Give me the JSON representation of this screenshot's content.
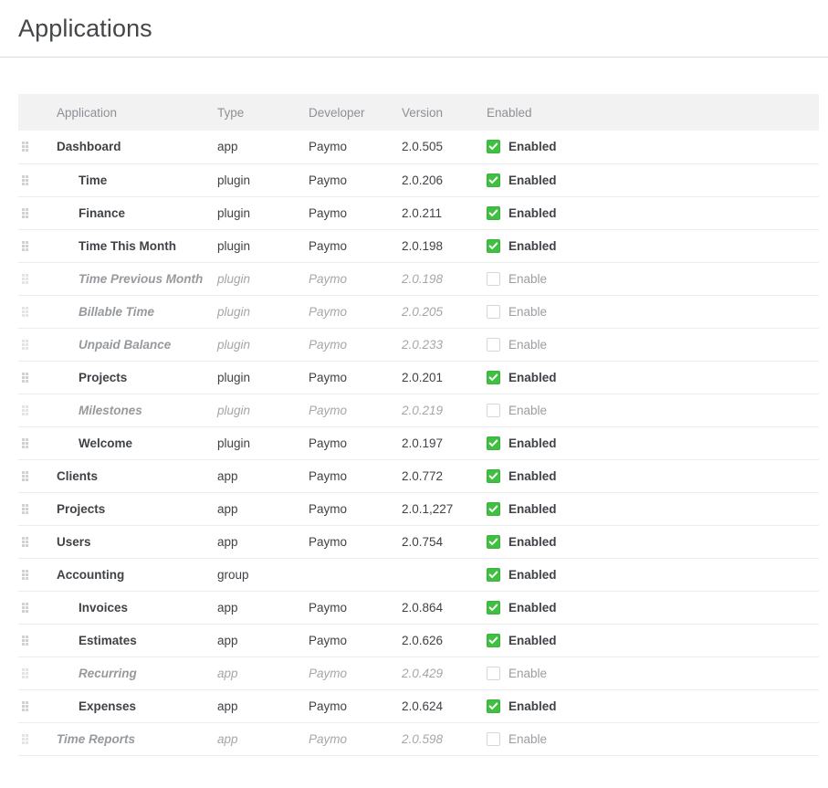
{
  "page": {
    "title": "Applications"
  },
  "table": {
    "columns": {
      "handle": "",
      "application": "Application",
      "type": "Type",
      "developer": "Developer",
      "version": "Version",
      "enabled": "Enabled"
    },
    "labels": {
      "enabled": "Enabled",
      "disabled": "Enable"
    },
    "colors": {
      "checkbox_on": "#40c040",
      "checkbox_off_border": "#d4d6d8",
      "header_bg": "#f2f2f2",
      "row_border": "#ececec",
      "text": "#3f4246",
      "muted_text": "#8d9095"
    },
    "icons": {
      "drag": "drag-handle-icon",
      "check": "check-icon"
    },
    "rows": [
      {
        "name": "Dashboard",
        "level": 1,
        "type": "app",
        "developer": "Paymo",
        "version": "2.0.505",
        "enabled": true,
        "enabled_label": "Enabled"
      },
      {
        "name": "Time",
        "level": 2,
        "type": "plugin",
        "developer": "Paymo",
        "version": "2.0.206",
        "enabled": true,
        "enabled_label": "Enabled"
      },
      {
        "name": "Finance",
        "level": 2,
        "type": "plugin",
        "developer": "Paymo",
        "version": "2.0.211",
        "enabled": true,
        "enabled_label": "Enabled"
      },
      {
        "name": "Time This Month",
        "level": 2,
        "type": "plugin",
        "developer": "Paymo",
        "version": "2.0.198",
        "enabled": true,
        "enabled_label": "Enabled"
      },
      {
        "name": "Time Previous Month",
        "level": 2,
        "type": "plugin",
        "developer": "Paymo",
        "version": "2.0.198",
        "enabled": false,
        "enabled_label": "Enable"
      },
      {
        "name": "Billable Time",
        "level": 2,
        "type": "plugin",
        "developer": "Paymo",
        "version": "2.0.205",
        "enabled": false,
        "enabled_label": "Enable"
      },
      {
        "name": "Unpaid Balance",
        "level": 2,
        "type": "plugin",
        "developer": "Paymo",
        "version": "2.0.233",
        "enabled": false,
        "enabled_label": "Enable"
      },
      {
        "name": "Projects",
        "level": 2,
        "type": "plugin",
        "developer": "Paymo",
        "version": "2.0.201",
        "enabled": true,
        "enabled_label": "Enabled"
      },
      {
        "name": "Milestones",
        "level": 2,
        "type": "plugin",
        "developer": "Paymo",
        "version": "2.0.219",
        "enabled": false,
        "enabled_label": "Enable"
      },
      {
        "name": "Welcome",
        "level": 2,
        "type": "plugin",
        "developer": "Paymo",
        "version": "2.0.197",
        "enabled": true,
        "enabled_label": "Enabled"
      },
      {
        "name": "Clients",
        "level": 1,
        "type": "app",
        "developer": "Paymo",
        "version": "2.0.772",
        "enabled": true,
        "enabled_label": "Enabled"
      },
      {
        "name": "Projects",
        "level": 1,
        "type": "app",
        "developer": "Paymo",
        "version": "2.0.1,227",
        "enabled": true,
        "enabled_label": "Enabled"
      },
      {
        "name": "Users",
        "level": 1,
        "type": "app",
        "developer": "Paymo",
        "version": "2.0.754",
        "enabled": true,
        "enabled_label": "Enabled"
      },
      {
        "name": "Accounting",
        "level": 1,
        "type": "group",
        "developer": "",
        "version": "",
        "enabled": true,
        "enabled_label": "Enabled"
      },
      {
        "name": "Invoices",
        "level": 2,
        "type": "app",
        "developer": "Paymo",
        "version": "2.0.864",
        "enabled": true,
        "enabled_label": "Enabled"
      },
      {
        "name": "Estimates",
        "level": 2,
        "type": "app",
        "developer": "Paymo",
        "version": "2.0.626",
        "enabled": true,
        "enabled_label": "Enabled"
      },
      {
        "name": "Recurring",
        "level": 2,
        "type": "app",
        "developer": "Paymo",
        "version": "2.0.429",
        "enabled": false,
        "enabled_label": "Enable"
      },
      {
        "name": "Expenses",
        "level": 2,
        "type": "app",
        "developer": "Paymo",
        "version": "2.0.624",
        "enabled": true,
        "enabled_label": "Enabled"
      },
      {
        "name": "Time Reports",
        "level": 1,
        "type": "app",
        "developer": "Paymo",
        "version": "2.0.598",
        "enabled": false,
        "enabled_label": "Enable"
      }
    ]
  }
}
